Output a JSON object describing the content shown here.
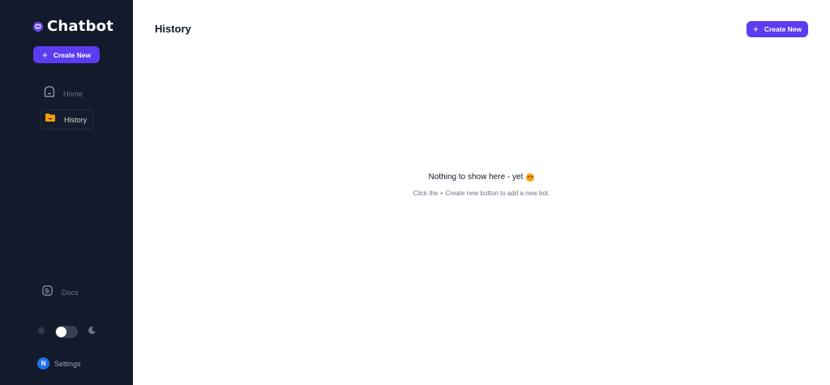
{
  "sidebar": {
    "brand": "Chatbot",
    "create_button": {
      "label": "Create New"
    },
    "nav": [
      {
        "label": "Home",
        "icon": "home-icon",
        "active": false
      },
      {
        "label": "History",
        "icon": "folder-icon",
        "active": true
      }
    ],
    "docs": {
      "label": "Docs",
      "icon": "document-icon"
    },
    "theme": {
      "light_icon": "sun-icon",
      "dark_icon": "moon-icon",
      "mode": "light"
    },
    "settings": {
      "avatar_initial": "N",
      "label": "Settings"
    }
  },
  "main": {
    "title": "History",
    "create_button": {
      "label": "Create New"
    },
    "empty_state": {
      "title": "Nothing to show here - yet",
      "subtitle_prefix": "Click the ",
      "subtitle_link": "+ Create new",
      "subtitle_suffix": " button to add a new bot."
    }
  },
  "colors": {
    "sidebar_bg": "#131a2b",
    "accent": "#5b3cf0",
    "active_icon": "#f59e0b",
    "avatar": "#1d72e8"
  }
}
